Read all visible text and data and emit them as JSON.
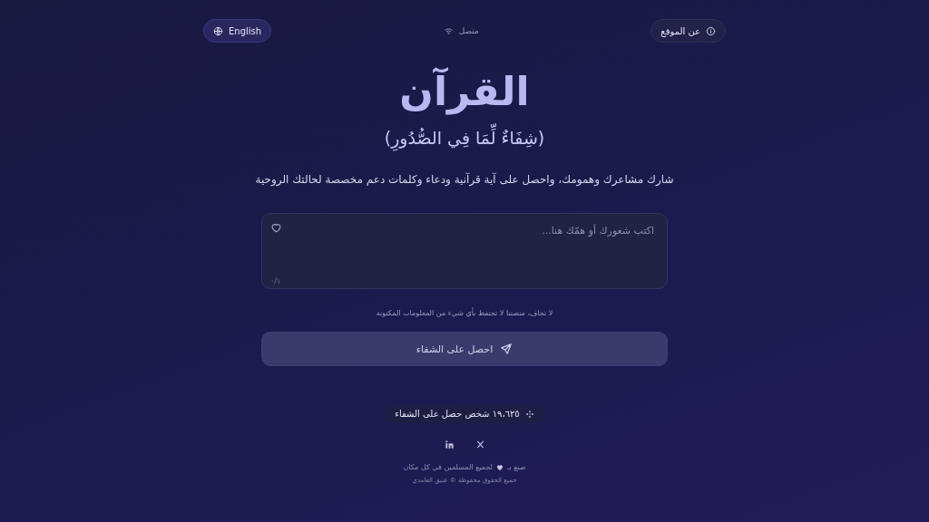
{
  "header": {
    "about": "عن الموقع",
    "status": {
      "label": "متصل",
      "online": true
    },
    "language": "English"
  },
  "title": "القرآن",
  "subtitle": "(شِفَاءٌ لِّمَا فِي الصُّدُورِ)",
  "description": "شارك مشاعرك وهمومك، واحصل على آية قرآنية ودعاء وكلمات دعم مخصصة لحالتك الروحية",
  "input": {
    "placeholder": "اكتب شعورك أو همّك هنا...",
    "counter": "٠/١"
  },
  "privacy_note": "لا تخاف، منصتنا لا تحتفظ بأي شيء من المعلومات المكتوبة",
  "submit": {
    "label": "احصل على الشفاء",
    "disabled": true
  },
  "stats": "١٩،٦٢٥ شخص حصل على الشفاء",
  "footer": {
    "made_with": "صنع بـ",
    "made_for": "لجميع المسلمين في كل مكان",
    "copyright": "جميع الحقوق محفوظة © عتيق الغامدي"
  }
}
